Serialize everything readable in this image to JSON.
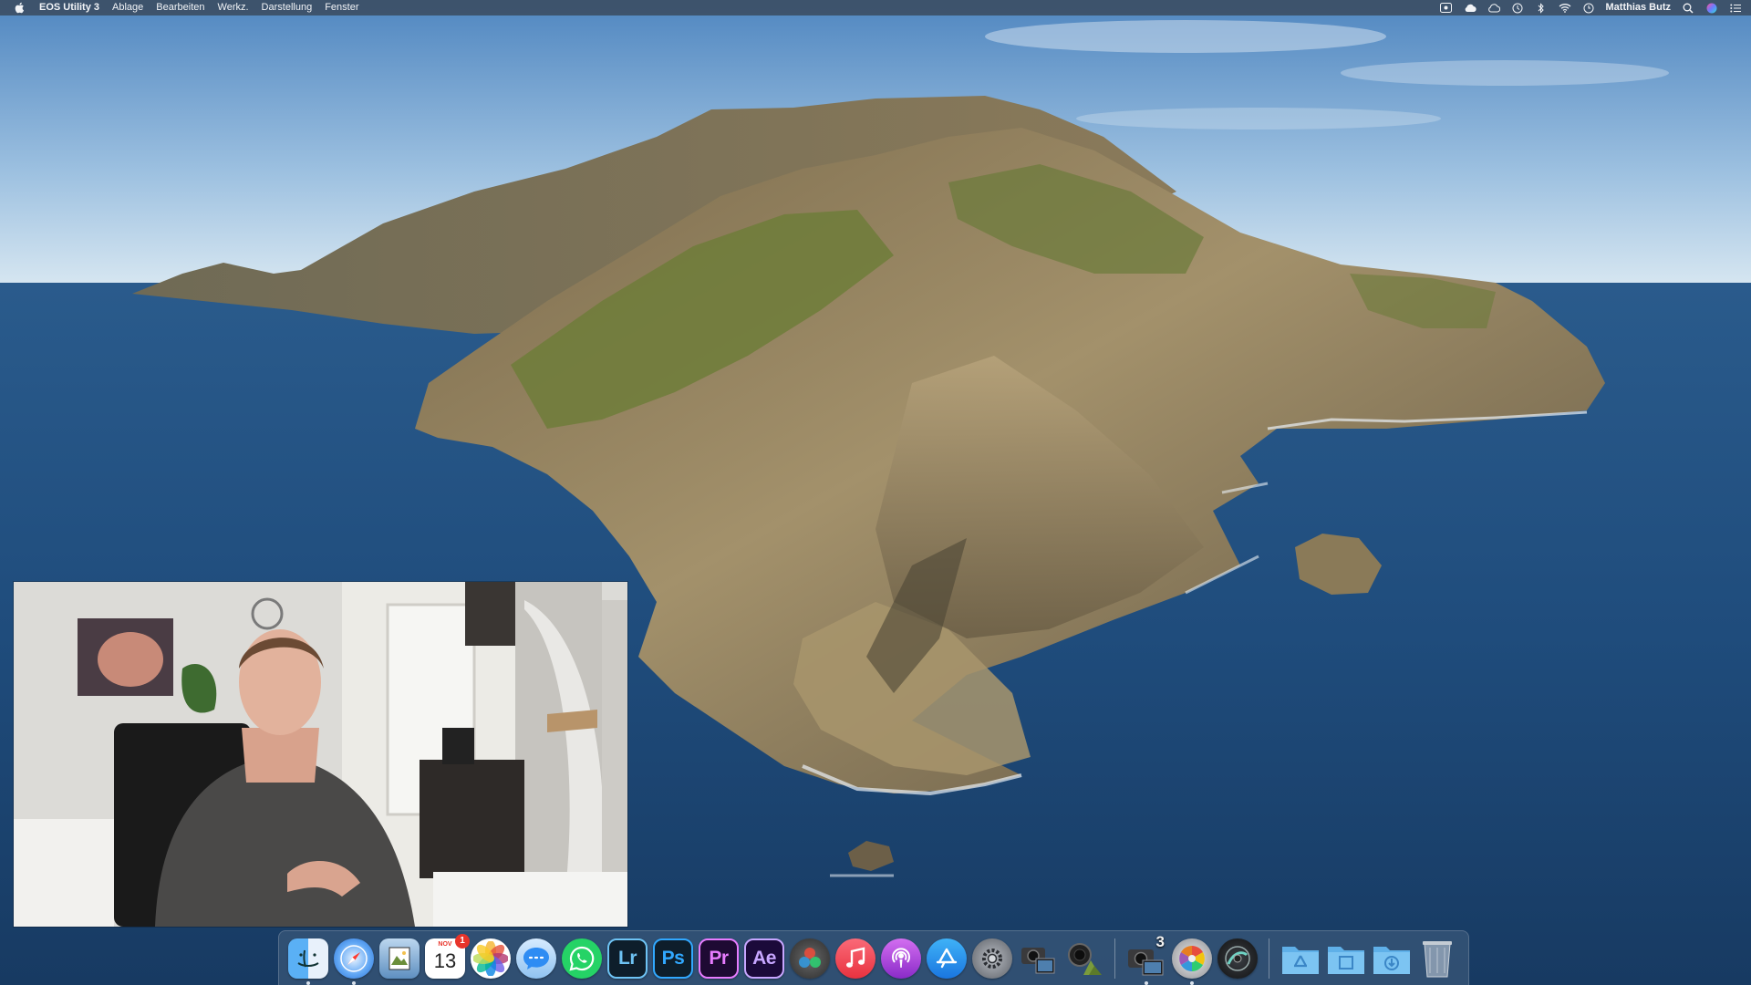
{
  "menubar": {
    "app_name": "EOS Utility 3",
    "menus": [
      "Ablage",
      "Bearbeiten",
      "Werkz.",
      "Darstellung",
      "Fenster"
    ],
    "status_icons": [
      "screen-record-icon",
      "creative-cloud-icon",
      "cloud-icon",
      "time-machine-icon",
      "bluetooth-icon",
      "wifi-icon",
      "clock-icon"
    ],
    "user_name": "Matthias Butz"
  },
  "desktop": {
    "wallpaper": "catalina-island",
    "colors": {
      "sky_top": "#5d8fc4",
      "sky_horizon": "#cfe0ee",
      "sea": "#1e4a78",
      "sea_deep": "#173c66",
      "rock": "#8a7a5e",
      "grass": "#6f7d3c"
    }
  },
  "webcam": {
    "description_icon": "presenter-video-overlay"
  },
  "dock": {
    "apps": [
      {
        "id": "finder",
        "icon": "finder-icon",
        "color": "#3b8fe0",
        "running": true
      },
      {
        "id": "safari",
        "icon": "safari-icon",
        "color": "#2f7fe8",
        "running": true
      },
      {
        "id": "preview",
        "icon": "preview-icon",
        "color": "#7aa9d6",
        "running": false
      },
      {
        "id": "calendar",
        "icon": "calendar-icon",
        "month": "NOV",
        "day": "13",
        "badge": "1",
        "running": false
      },
      {
        "id": "photos",
        "icon": "photos-icon",
        "running": false
      },
      {
        "id": "messages",
        "icon": "messages-icon",
        "color": "#2e8cf3",
        "running": false
      },
      {
        "id": "whatsapp",
        "icon": "whatsapp-icon",
        "color": "#25d366",
        "running": false
      },
      {
        "id": "lightroom",
        "icon": "lightroom-icon",
        "label": "Lr",
        "color": "#0e1e2b",
        "fg": "#6ec3f4",
        "running": false
      },
      {
        "id": "photoshop",
        "icon": "photoshop-icon",
        "label": "Ps",
        "color": "#0e1e2b",
        "fg": "#31a8ff",
        "running": false
      },
      {
        "id": "premiere",
        "icon": "premiere-icon",
        "label": "Pr",
        "color": "#1e0a33",
        "fg": "#e77cff",
        "running": false
      },
      {
        "id": "after-effects",
        "icon": "after-effects-icon",
        "label": "Ae",
        "color": "#1b0a3a",
        "fg": "#c7a6ff",
        "running": false
      },
      {
        "id": "davinci",
        "icon": "davinci-resolve-icon",
        "running": false
      },
      {
        "id": "music",
        "icon": "music-icon",
        "color": "#f0424e",
        "running": false
      },
      {
        "id": "podcasts",
        "icon": "podcasts-icon",
        "color": "#a43bd8",
        "running": false
      },
      {
        "id": "app-store",
        "icon": "app-store-icon",
        "color": "#1f8ef1",
        "running": false
      },
      {
        "id": "system-preferences",
        "icon": "system-preferences-icon",
        "color": "#8a8d93",
        "running": false
      },
      {
        "id": "eos-utility-launcher",
        "icon": "camera-monitor-icon",
        "running": false
      },
      {
        "id": "eos-lens-registration",
        "icon": "camera-lens-icon",
        "running": false
      },
      {
        "id": "eos-utility",
        "icon": "eos-utility-icon",
        "label": "3",
        "running": true
      },
      {
        "id": "picture-style-editor",
        "icon": "color-wheel-icon",
        "running": true
      },
      {
        "id": "digital-photo-professional",
        "icon": "dpp-icon",
        "running": false
      }
    ],
    "stacks": [
      {
        "id": "applications",
        "icon": "applications-folder-icon"
      },
      {
        "id": "documents",
        "icon": "documents-folder-icon"
      },
      {
        "id": "downloads",
        "icon": "downloads-folder-icon"
      },
      {
        "id": "trash",
        "icon": "trash-icon"
      }
    ]
  }
}
